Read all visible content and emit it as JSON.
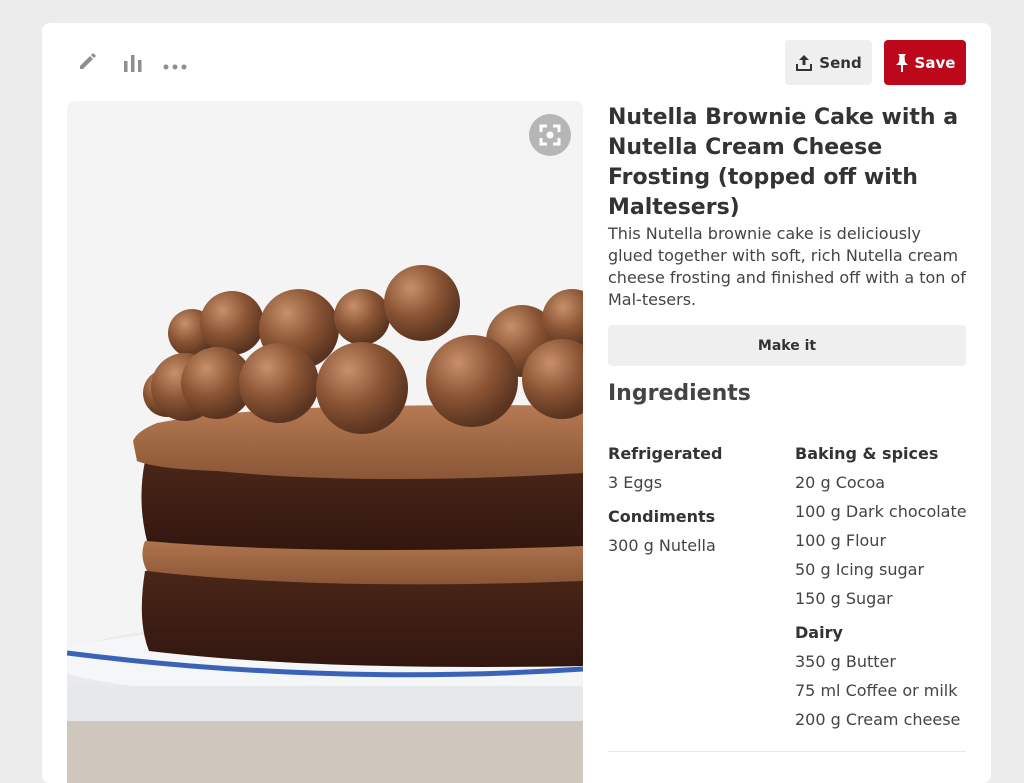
{
  "toolbar": {
    "edit_icon": "pencil-icon",
    "stats_icon": "bar-chart-icon",
    "more_icon": "ellipsis-icon",
    "send_label": "Send",
    "save_label": "Save",
    "save_color": "#bd081c"
  },
  "pin": {
    "title": "Nutella Brownie Cake with a Nutella Cream Cheese Frosting (topped off with Maltesers)",
    "description": "This Nutella brownie cake is deliciously glued together with soft, rich Nutella cream cheese frosting and finished off with a ton of Mal-tesers.",
    "make_it_label": "Make it",
    "ingredients_heading": "Ingredients"
  },
  "ingredients": {
    "left": [
      {
        "category": "Refrigerated",
        "items": [
          "3 Eggs"
        ]
      },
      {
        "category": "Condiments",
        "items": [
          "300 g Nutella"
        ]
      }
    ],
    "right": [
      {
        "category": "Baking & spices",
        "items": [
          "20 g Cocoa",
          "100 g Dark chocolate",
          "100 g Flour",
          "50 g Icing sugar",
          "150 g Sugar"
        ]
      },
      {
        "category": "Dairy",
        "items": [
          "350 g Butter",
          "75 ml Coffee or milk",
          "200 g Cream cheese"
        ]
      }
    ]
  }
}
